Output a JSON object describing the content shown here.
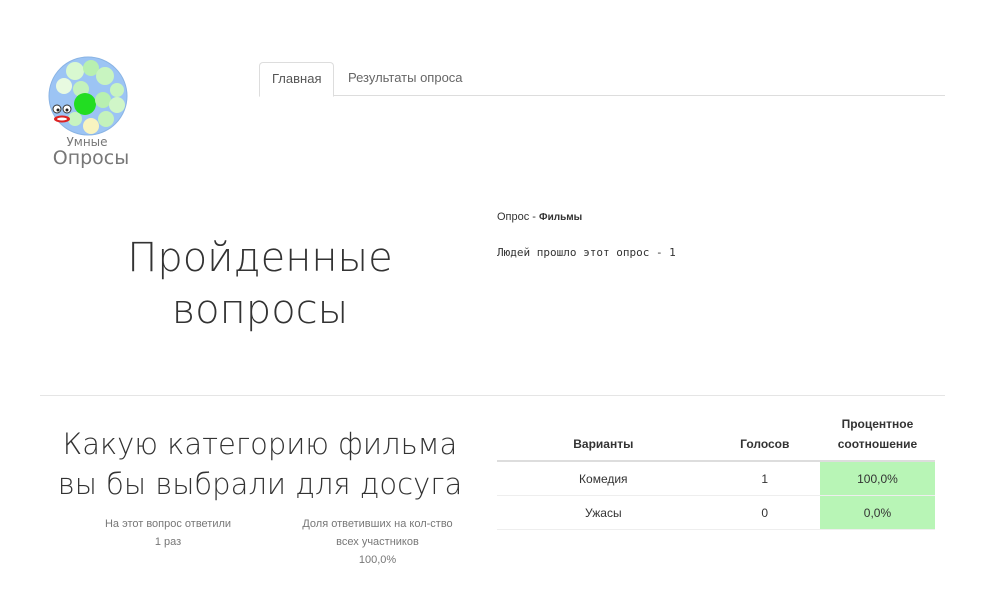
{
  "logo": {
    "line1": "Умные",
    "line2": "Опросы",
    "icon": "bubbles-logo-icon"
  },
  "tabs": [
    {
      "label": "Главная",
      "active": true
    },
    {
      "label": "Результаты опроса",
      "active": false
    }
  ],
  "hero": {
    "line1": "Пройденные",
    "line2": "вопросы"
  },
  "survey": {
    "prefix": "Опрос - ",
    "name": "Фильмы",
    "people": "Людей прошло этот опрос - 1"
  },
  "question": {
    "line1": "Какую категорию фильма",
    "line2": "вы бы выбрали для досуга",
    "answered_label": "На этот вопрос ответили",
    "answered_value": "1 раз",
    "share_label_line1": "Доля ответивших на кол-ство",
    "share_label_line2": "всех участников",
    "share_value": "100,0%"
  },
  "table": {
    "headers": {
      "variants": "Варианты",
      "votes": "Голосов",
      "percent_line1": "Процентное",
      "percent_line2": "соотношение"
    },
    "rows": [
      {
        "variant": "Комедия",
        "votes": "1",
        "percent": "100,0%"
      },
      {
        "variant": "Ужасы",
        "votes": "0",
        "percent": "0,0%"
      }
    ],
    "highlight_color": "#b8f5b6"
  }
}
